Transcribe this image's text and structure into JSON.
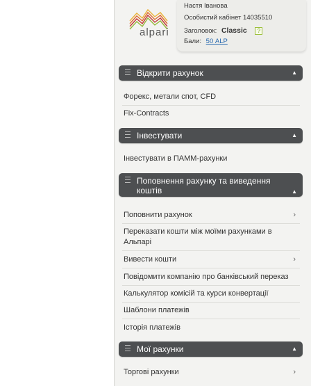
{
  "user": {
    "name": "Настя Іванова",
    "cabinet": "Особистий кабінет 14035510",
    "title_label": "Заголовок:",
    "title_value": "Classic",
    "help": "?",
    "points_label": "Бали:",
    "points_value": "50 ALP"
  },
  "logo": {
    "text": "alpari"
  },
  "sections": [
    {
      "title": "Відкрити рахунок",
      "items": [
        "Форекс, метали спот, CFD",
        "Fix-Contracts"
      ]
    },
    {
      "title": "Інвестувати",
      "items": [
        "Інвестувати в ПАММ-рахунки"
      ]
    },
    {
      "title_line1": "Поповнення рахунку та виведення",
      "title_line2": "коштів",
      "items": [
        "Поповнити рахунок",
        "Переказати кошти між моїми рахунками в",
        "Альпарі",
        "Вивести кошти",
        "Повідомити компанію про банківський переказ",
        "Калькулятор комісій та курси конвертації",
        "Шаблони платежів",
        "Історія платежів"
      ]
    },
    {
      "title": "Мої рахунки",
      "items": [
        "Торгові рахунки"
      ]
    }
  ],
  "icons": {
    "collapse": "▲",
    "chevron": "›"
  }
}
